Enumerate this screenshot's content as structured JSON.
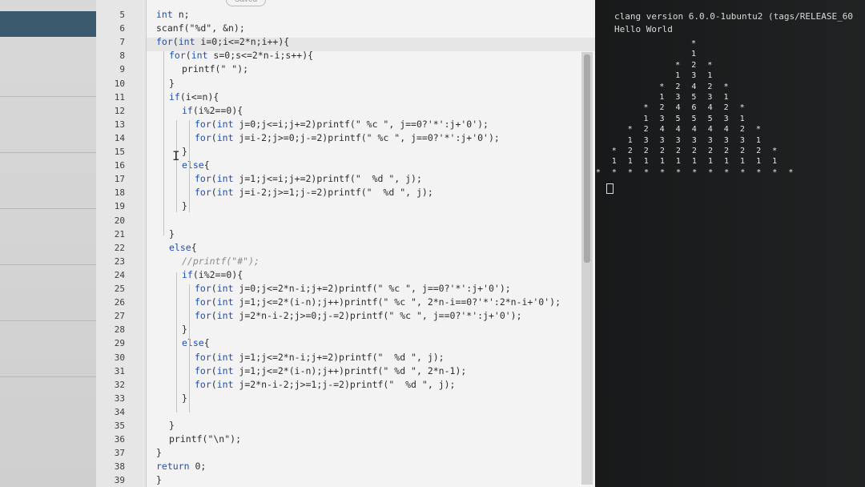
{
  "editor": {
    "tab_hint": "Saved",
    "line_numbers": [
      "5",
      "6",
      "7",
      "8",
      "9",
      "10",
      "11",
      "12",
      "13",
      "14",
      "15",
      "16",
      "17",
      "18",
      "19",
      "20",
      "21",
      "22",
      "23",
      "24",
      "25",
      "26",
      "27",
      "28",
      "29",
      "30",
      "31",
      "32",
      "33",
      "34",
      "35",
      "36",
      "37",
      "38",
      "39"
    ],
    "lines": [
      "int n;",
      "scanf(\"%d\", &n);",
      "for(int i=0;i<=2*n;i++){",
      "  for(int s=0;s<=2*n-i;s++){",
      "    printf(\" \");",
      "  }",
      "  if(i<=n){",
      "    if(i%2==0){",
      "      for(int j=0;j<=i;j+=2)printf(\" %c \", j==0?'*':j+'0');",
      "      for(int j=i-2;j>=0;j-=2)printf(\" %c \", j==0?'*':j+'0');",
      "    }",
      "    else{",
      "      for(int j=1;j<=i;j+=2)printf(\"  %d \", j);",
      "      for(int j=i-2;j>=1;j-=2)printf(\"  %d \", j);",
      "    }",
      "",
      "  }",
      "  else{",
      "    //printf(\"#\");",
      "    if(i%2==0){",
      "      for(int j=0;j<=2*n-i;j+=2)printf(\" %c \", j==0?'*':j+'0');",
      "      for(int j=1;j<=2*(i-n);j++)printf(\" %c \", 2*n-i==0?'*':2*n-i+'0');",
      "      for(int j=2*n-i-2;j>=0;j-=2)printf(\" %c \", j==0?'*':j+'0');",
      "    }",
      "    else{",
      "      for(int j=1;j<=2*n-i;j+=2)printf(\"  %d \", j);",
      "      for(int j=1;j<=2*(i-n);j++)printf(\" %d \", 2*n-1);",
      "      for(int j=2*n-i-2;j>=1;j-=2)printf(\"  %d \", j);",
      "    }",
      "",
      "  }",
      "  printf(\"\\n\");",
      "}",
      "return 0;",
      "}"
    ]
  },
  "terminal": {
    "header": [
      "clang version 6.0.0-1ubuntu2 (tags/RELEASE_60",
      "Hello World"
    ],
    "triangle": [
      "*",
      "1",
      "* 2 *",
      "1 3 1",
      "* 2 4 2 *",
      "1 3 5 3 1",
      "* 2 4 6 4 2 *",
      "1 3 5 5 5 3 1",
      "* 2 4 4 4 4 4 2 *",
      "1 3 3 3 3 3 3 3 1",
      "* 2 2 2 2 2 2 2 2 2 *",
      "1 1 1 1 1 1 1 1 1 1 1",
      "* * * * * * * * * * * * *"
    ]
  }
}
